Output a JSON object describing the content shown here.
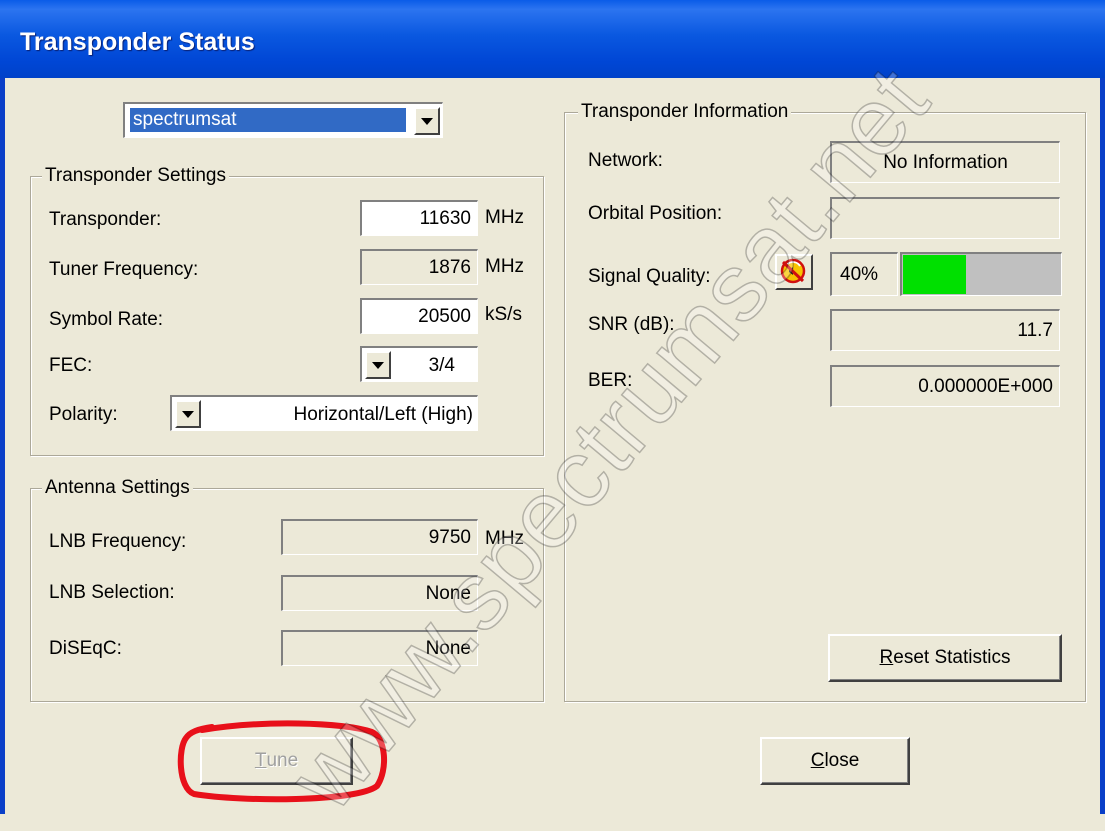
{
  "window": {
    "title": "Transponder Status"
  },
  "satellite_select": {
    "value": "spectrumsat"
  },
  "transponder_settings": {
    "legend": "Transponder Settings",
    "transponder_label": "Transponder:",
    "transponder_value": "11630",
    "transponder_unit": "MHz",
    "tuner_freq_label": "Tuner Frequency:",
    "tuner_freq_value": "1876",
    "tuner_freq_unit": "MHz",
    "symbol_rate_label": "Symbol Rate:",
    "symbol_rate_value": "20500",
    "symbol_rate_unit": "kS/s",
    "fec_label": "FEC:",
    "fec_value": "3/4",
    "polarity_label": "Polarity:",
    "polarity_value": "Horizontal/Left (High)"
  },
  "antenna_settings": {
    "legend": "Antenna Settings",
    "lnb_freq_label": "LNB Frequency:",
    "lnb_freq_value": "9750",
    "lnb_freq_unit": "MHz",
    "lnb_selection_label": "LNB Selection:",
    "lnb_selection_value": "None",
    "diseqc_label": "DiSEqC:",
    "diseqc_value": "None"
  },
  "transponder_information": {
    "legend": "Transponder Information",
    "network_label": "Network:",
    "network_value": "No Information",
    "orbital_label": "Orbital Position:",
    "orbital_value": "",
    "signal_label": "Signal Quality:",
    "signal_percent_text": "40%",
    "signal_fraction": 0.4,
    "signal_color": "#00E000",
    "snr_label": "SNR (dB):",
    "snr_value": "11.7",
    "ber_label": "BER:",
    "ber_value": "0.000000E+000",
    "reset_button_prefix": "",
    "reset_button_ul": "R",
    "reset_button_rest": "eset Statistics"
  },
  "buttons": {
    "tune_ul": "T",
    "tune_rest": "une",
    "close_ul": "C",
    "close_rest": "lose"
  },
  "watermark": "www.spectrumsat.net",
  "colors": {
    "title_bar": "#0054E3",
    "dialog_bg": "#ECE9D8",
    "highlight_select": "#316AC5",
    "annotation_circle": "#E8101A"
  }
}
